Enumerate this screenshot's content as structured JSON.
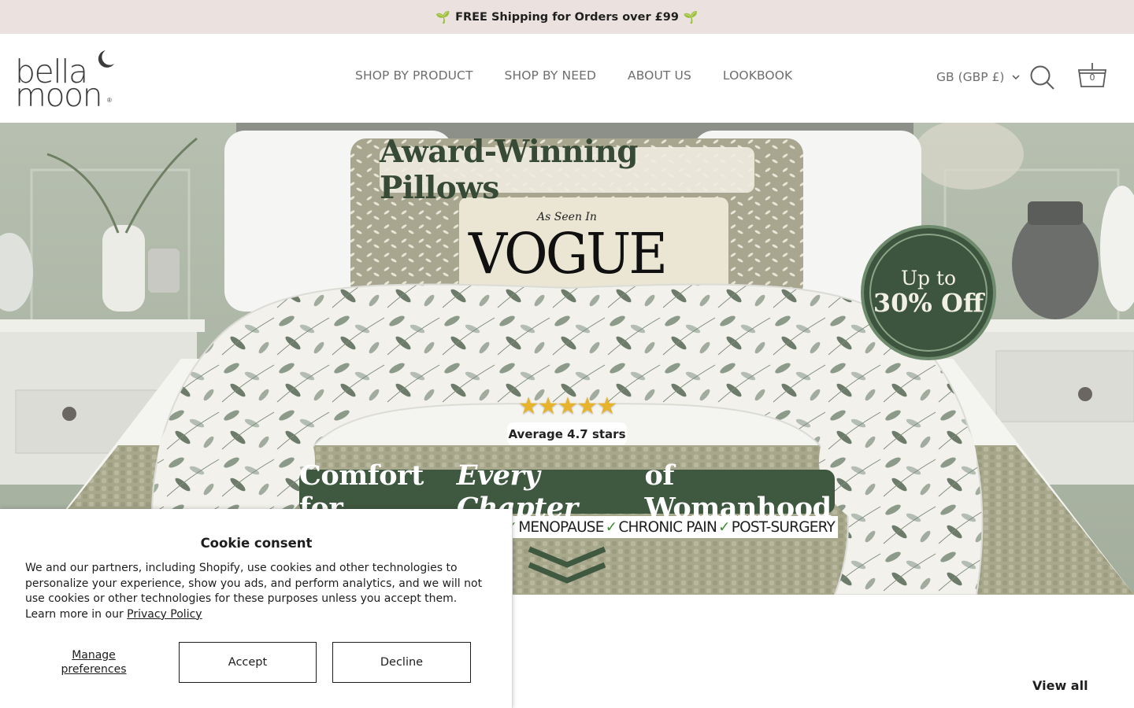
{
  "announcement": {
    "text": "FREE Shipping for Orders over £99",
    "leading_icon": "seedling-icon",
    "trailing_icon": "seedling-icon"
  },
  "header": {
    "logo": {
      "line1": "bella",
      "line2": "moon",
      "mark": "®"
    },
    "nav": [
      {
        "label": "SHOP BY PRODUCT"
      },
      {
        "label": "SHOP BY NEED"
      },
      {
        "label": "ABOUT US"
      },
      {
        "label": "LOOKBOOK"
      }
    ],
    "currency": {
      "label": "GB (GBP £)"
    },
    "cart": {
      "count": "0"
    }
  },
  "hero": {
    "title": "Award-Winning Pillows",
    "seen_in": "As Seen In",
    "vogue": "VOGUE",
    "badge": {
      "line1": "Up to",
      "line2": "30% Off"
    },
    "stars": "★★★★★",
    "rating": "Average 4.7 stars",
    "rating_value": 4.7,
    "tagline": {
      "part1": "Comfort for",
      "emphasis": "Every Chapter",
      "part2": "of Womanhood"
    },
    "conditions": [
      "MENOPAUSE",
      "CHRONIC PAIN",
      "POST-SURGERY"
    ],
    "tick": "✓"
  },
  "section": {
    "view_all": "View all"
  },
  "cookie": {
    "title": "Cookie consent",
    "body": "We and our partners, including Shopify, use cookies and other technologies to personalize your experience, show you ads, and perform analytics, and we will not use cookies or other technologies for these purposes unless you accept them. Learn more in our",
    "link": "Privacy Policy",
    "manage": "Manage preferences",
    "accept": "Accept",
    "decline": "Decline"
  },
  "colors": {
    "announcement_bg": "#ebe1de",
    "brand_green": "#3f5840",
    "nav_text": "#6e6e6e"
  }
}
